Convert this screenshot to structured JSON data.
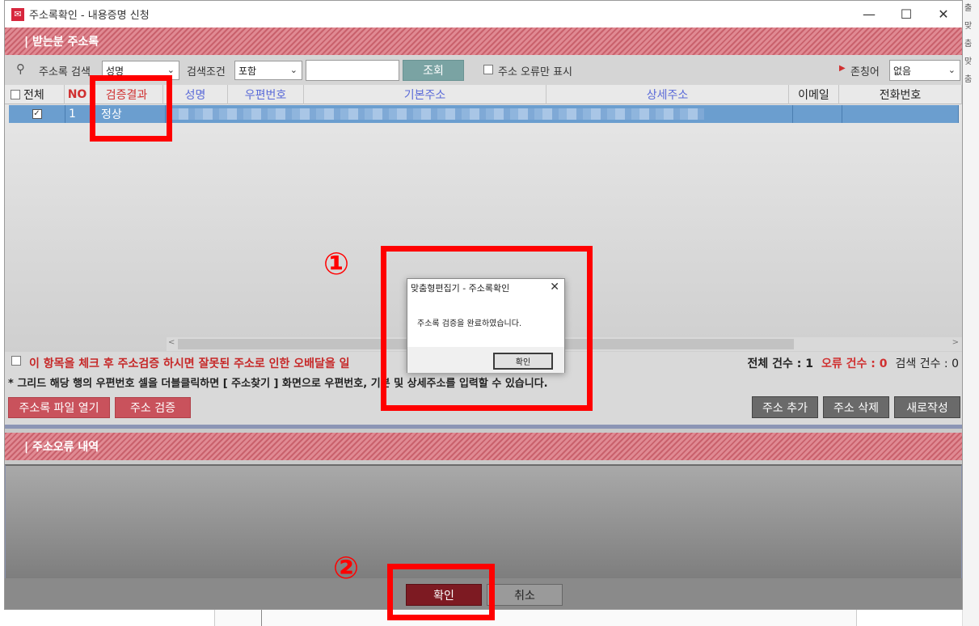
{
  "window": {
    "title": "주소록확인 - 내용증명 신청",
    "minimize": "—",
    "maximize": "☐",
    "close": "✕"
  },
  "recipients": {
    "header": "| 받는분 주소록"
  },
  "search": {
    "label": "주소록 검색",
    "field_value": "성명",
    "condition_label": "검색조건",
    "condition_value": "포함",
    "query_value": "",
    "button": "조회",
    "error_only_label": "주소 오류만 표시",
    "honorific_label": "존칭어",
    "honorific_value": "없음"
  },
  "grid": {
    "columns": [
      "전체",
      "NO",
      "검증결과",
      "성명",
      "우편번호",
      "기본주소",
      "상세주소",
      "이메일",
      "전화번호"
    ],
    "rows": [
      {
        "no": "1",
        "result": "정상"
      }
    ]
  },
  "info": {
    "warning": "이 항목을 체크 후 주소검증 하시면 잘못된 주소로 인한 오배달을 ",
    "warning_tail": "일",
    "hint": "* 그리드 해당 행의 우편번호 셀을 더블클릭하면 [ 주소찾기 ] 화면으로 우편번호, 기본 및 상세주소를 입력할 수 있습니다.",
    "total_label": "전체 건수 : 1",
    "error_label": "오류 건수 : 0",
    "search_count_label": "검색 건수 : 0"
  },
  "buttons": {
    "open_file": "주소록 파일 열기",
    "verify": "주소 검증",
    "add": "주소 추가",
    "delete": "주소 삭제",
    "new": "새로작성",
    "ok": "확인",
    "cancel": "취소"
  },
  "errors": {
    "header": "| 주소오류 내역"
  },
  "dialog": {
    "title": "맞춤형편집기 - 주소록확인",
    "message": "주소록 검증을 완료하였습니다.",
    "ok": "확인"
  },
  "annotations": {
    "one": "①",
    "two": "②",
    "color": "#ff0000"
  },
  "background": {
    "right_fragments": [
      "출",
      "맞춤",
      "맞춤"
    ]
  }
}
